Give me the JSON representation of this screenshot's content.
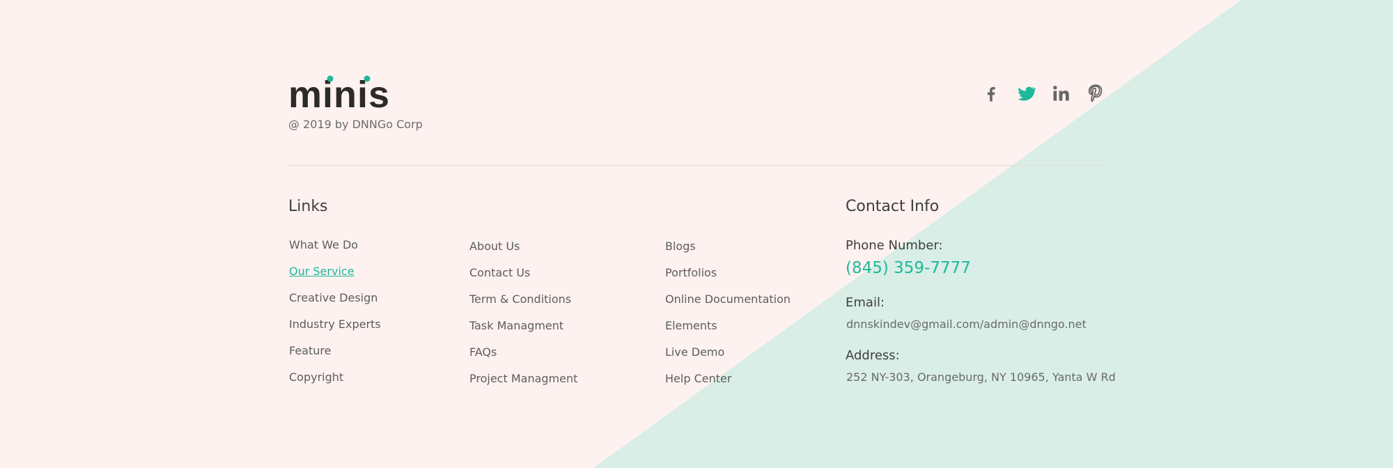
{
  "brand": {
    "name": "minis",
    "copyright": "@ 2019 by DNNGo Corp"
  },
  "social": [
    {
      "name": "facebook-icon",
      "color": "#666666"
    },
    {
      "name": "twitter-icon",
      "color": "#1fb89b"
    },
    {
      "name": "linkedin-icon",
      "color": "#666666"
    },
    {
      "name": "pinterest-icon",
      "color": "#666666"
    }
  ],
  "links": {
    "heading": "Links",
    "col1": [
      "What We Do",
      "Our Service",
      "Creative Design",
      "Industry Experts",
      "Feature",
      "Copyright"
    ],
    "col2": [
      "About Us",
      "Contact Us",
      "Term & Conditions",
      "Task Managment",
      "FAQs",
      "Project Managment"
    ],
    "col3": [
      "Blogs",
      "Portfolios",
      "Online Documentation",
      "Elements",
      "Live Demo",
      "Help Center"
    ],
    "active": "Our Service"
  },
  "contact": {
    "heading": "Contact Info",
    "phone_label": "Phone Number:",
    "phone": "(845) 359-7777",
    "email_label": "Email:",
    "email": "dnnskindev@gmail.com/admin@dnngo.net",
    "address_label": "Address:",
    "address": "252 NY-303, Orangeburg, NY 10965, Yanta W Rd"
  },
  "colors": {
    "accent": "#1fb89b",
    "background": "#fdf2ef",
    "diagonal": "#d8eee6"
  }
}
